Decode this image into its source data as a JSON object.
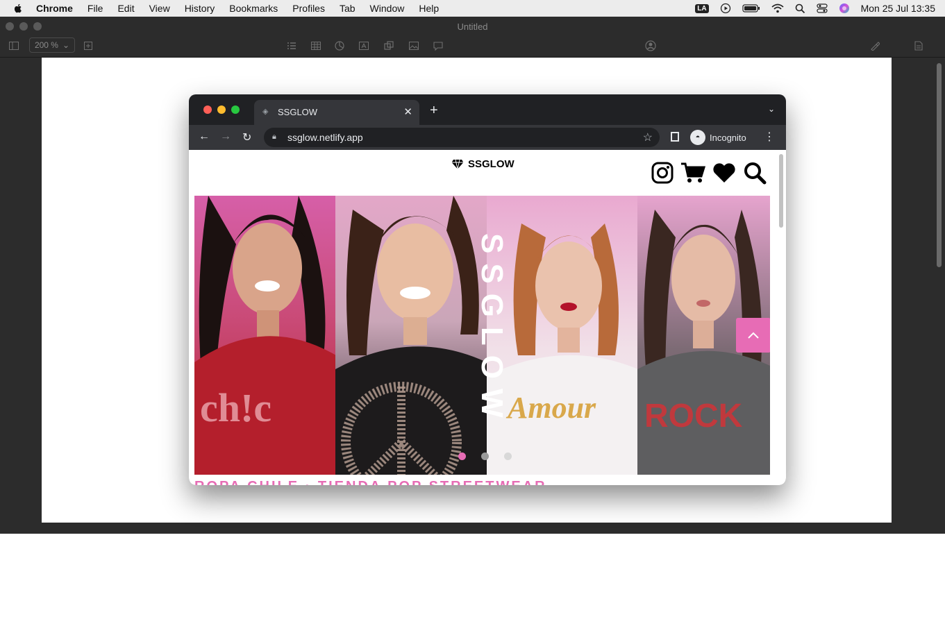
{
  "menubar": {
    "items": [
      "Chrome",
      "File",
      "Edit",
      "View",
      "History",
      "Bookmarks",
      "Profiles",
      "Tab",
      "Window",
      "Help"
    ],
    "status": {
      "keyboard": "LA",
      "clock": "Mon 25 Jul  13:35"
    }
  },
  "numbers_window": {
    "title": "Untitled",
    "zoom": "200 %"
  },
  "chrome": {
    "tab_title": "SSGLOW",
    "url": "ssglow.netlify.app",
    "profile_label": "Incognito"
  },
  "site": {
    "brand": "SSGLOW",
    "hero_word": "SSGLOW",
    "shirt_texts": [
      "ch!c",
      "Amour",
      "ROCK"
    ],
    "marquee": "ROPA CHILE · TIENDA POP STREETWEAR",
    "icons": [
      "instagram-icon",
      "cart-icon",
      "heart-icon",
      "search-icon"
    ]
  },
  "colors": {
    "accent_pink": "#e76cb5",
    "chrome_dark": "#202124",
    "numbers_bg": "#2c2c2c"
  }
}
